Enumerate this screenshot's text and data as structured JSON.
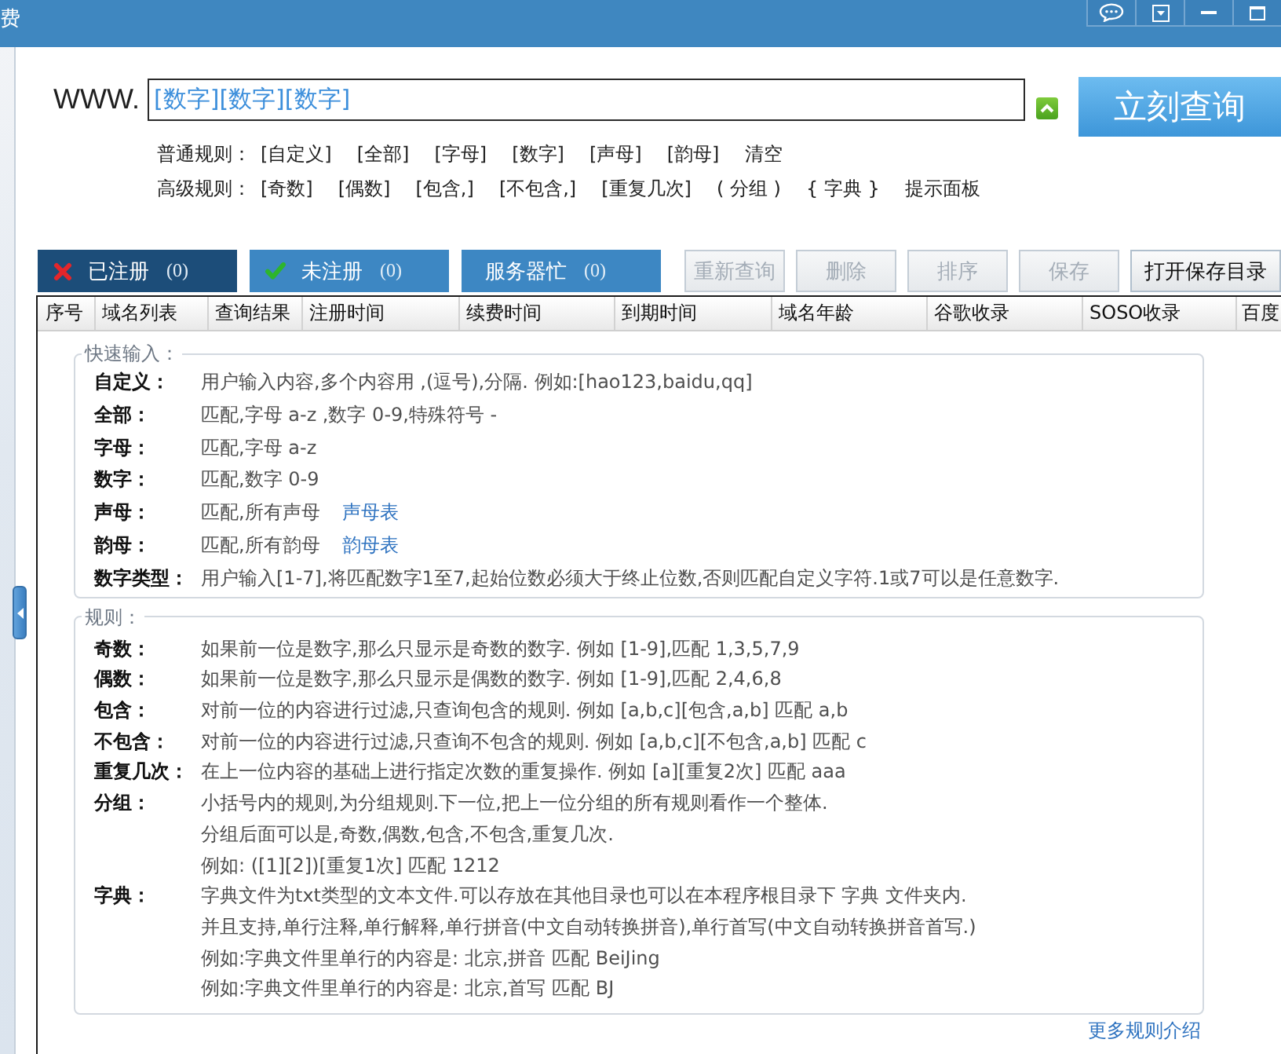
{
  "window": {
    "title": "费"
  },
  "search": {
    "prefix": "WWW.",
    "value": "[数字][数字][数字]",
    "button": "立刻查询"
  },
  "rule_rows": [
    {
      "label": "普通规则：",
      "items": [
        "[自定义]",
        "[全部]",
        "[字母]",
        "[数字]",
        "[声母]",
        "[韵母]",
        "清空"
      ]
    },
    {
      "label": "高级规则：",
      "items": [
        "[奇数]",
        "[偶数]",
        "[包含,]",
        "[不包含,]",
        "[重复几次]",
        "( 分组 )",
        "{ 字典 }",
        "提示面板"
      ]
    }
  ],
  "tabs": [
    {
      "kind": "registered",
      "label": "已注册",
      "count": "(0)",
      "selected": true
    },
    {
      "kind": "unregistered",
      "label": "未注册",
      "count": "(0)",
      "selected": false
    },
    {
      "kind": "busy",
      "label": "服务器忙",
      "count": "(0)",
      "selected": false
    }
  ],
  "toolbar": [
    {
      "label": "重新查询",
      "disabled": true
    },
    {
      "label": "删除",
      "disabled": true
    },
    {
      "label": "排序",
      "disabled": true
    },
    {
      "label": "保存",
      "disabled": true
    },
    {
      "label": "打开保存目录",
      "disabled": false
    }
  ],
  "table": {
    "columns": [
      "序号",
      "域名列表",
      "查询结果",
      "注册时间",
      "续费时间",
      "到期时间",
      "域名年龄",
      "谷歌收录",
      "SOSO收录",
      "百度"
    ]
  },
  "hint_panel": {
    "sections": [
      {
        "title": "快速输入：",
        "rows": [
          {
            "label": "自定义：",
            "lines": [
              "用户输入内容,多个内容用 ,(逗号),分隔. 例如:[hao123,baidu,qq]"
            ]
          },
          {
            "label": "全部：",
            "lines": [
              "匹配,字母 a-z ,数字 0-9,特殊符号 -"
            ]
          },
          {
            "label": "字母：",
            "lines": [
              "匹配,字母 a-z"
            ]
          },
          {
            "label": "数字：",
            "lines": [
              "匹配,数字 0-9"
            ]
          },
          {
            "label": "声母：",
            "lines": [
              "匹配,所有声母"
            ],
            "link": "声母表"
          },
          {
            "label": "韵母：",
            "lines": [
              "匹配,所有韵母"
            ],
            "link": "韵母表"
          },
          {
            "label": "数字类型：",
            "lines": [
              "用户输入[1-7],将匹配数字1至7,起始位数必须大于终止位数,否则匹配自定义字符.1或7可以是任意数字."
            ]
          }
        ]
      },
      {
        "title": "规则：",
        "rows": [
          {
            "label": "奇数：",
            "lines": [
              "如果前一位是数字,那么只显示是奇数的数字. 例如 [1-9],匹配 1,3,5,7,9"
            ]
          },
          {
            "label": "偶数：",
            "lines": [
              "如果前一位是数字,那么只显示是偶数的数字. 例如 [1-9],匹配 2,4,6,8"
            ]
          },
          {
            "label": "包含：",
            "lines": [
              "对前一位的内容进行过滤,只查询包含的规则. 例如 [a,b,c][包含,a,b] 匹配 a,b"
            ]
          },
          {
            "label": "不包含：",
            "lines": [
              "对前一位的内容进行过滤,只查询不包含的规则. 例如 [a,b,c][不包含,a,b] 匹配 c"
            ]
          },
          {
            "label": "重复几次：",
            "lines": [
              "在上一位内容的基础上进行指定次数的重复操作. 例如 [a][重复2次] 匹配 aaa"
            ]
          },
          {
            "label": "分组：",
            "lines": [
              "小括号内的规则,为分组规则.下一位,把上一位分组的所有规则看作一个整体.",
              "分组后面可以是,奇数,偶数,包含,不包含,重复几次.",
              "例如: ([1][2])[重复1次] 匹配 1212"
            ]
          },
          {
            "label": "字典：",
            "lines": [
              "字典文件为txt类型的文本文件.可以存放在其他目录也可以在本程序根目录下 字典 文件夹内.",
              "并且支持,单行注释,单行解释,单行拼音(中文自动转换拼音),单行首写(中文自动转换拼音首写.)",
              "例如:字典文件里单行的内容是: 北京,拼音 匹配 BeiJing",
              "例如:字典文件里单行的内容是: 北京,首写 匹配 BJ"
            ]
          }
        ]
      }
    ],
    "more_link": "更多规则介绍"
  }
}
